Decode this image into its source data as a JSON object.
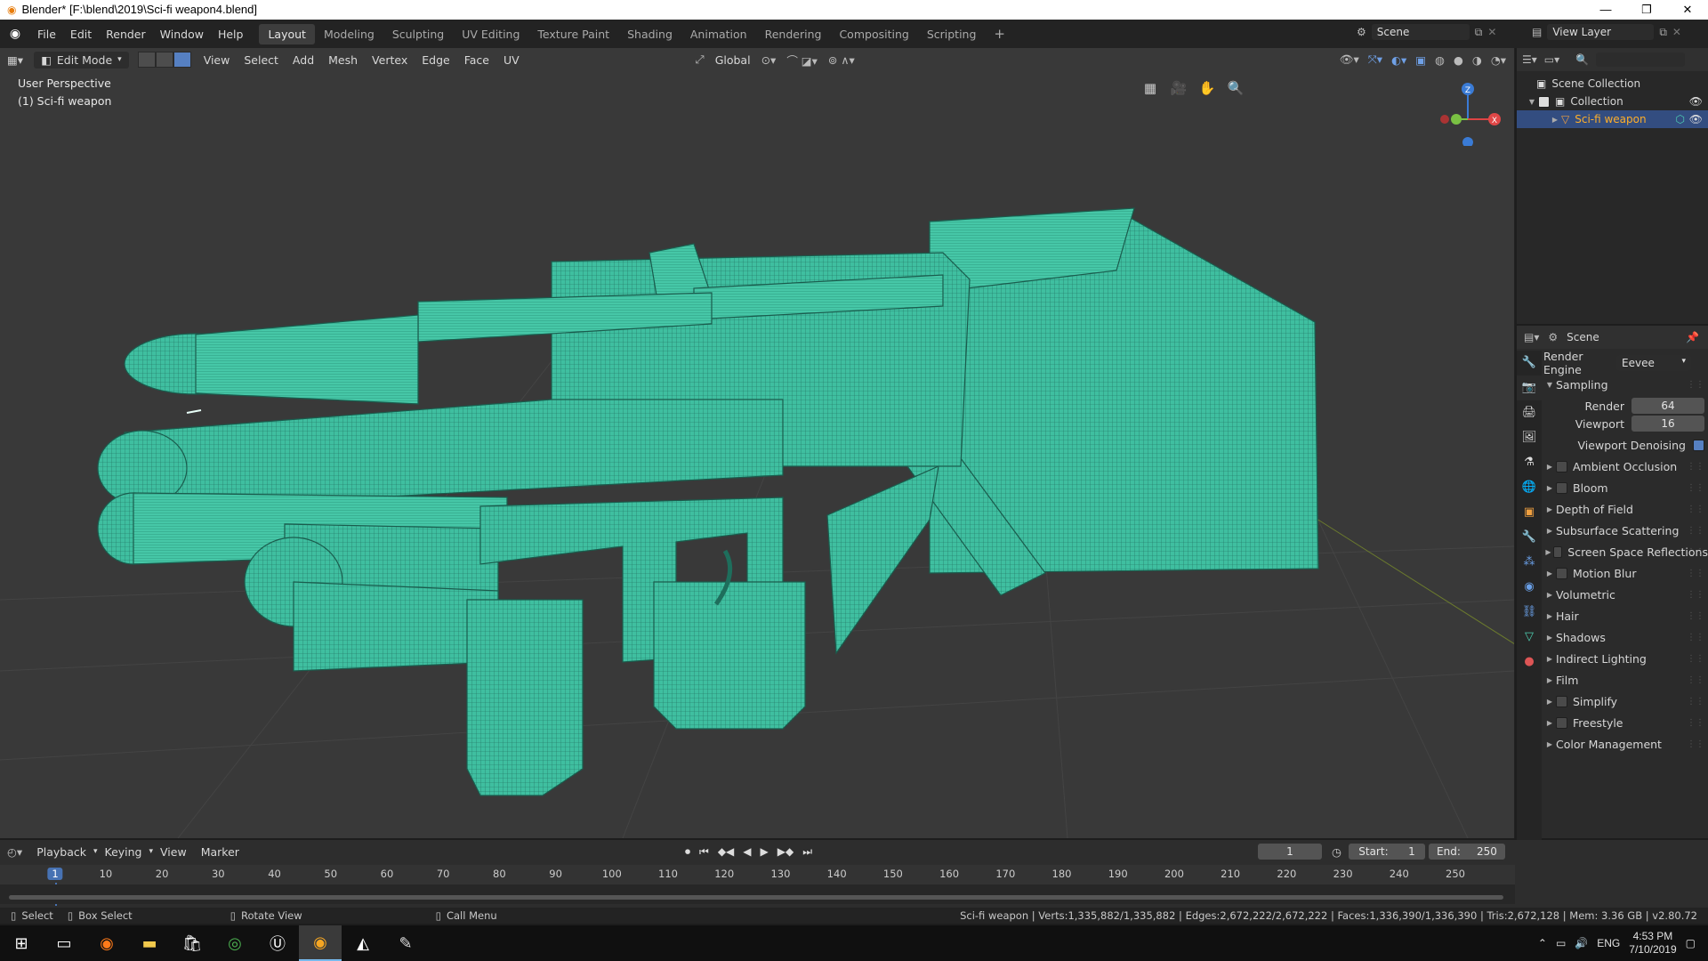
{
  "window": {
    "title": "Blender* [F:\\blend\\2019\\Sci-fi weapon4.blend]",
    "controls": [
      "—",
      "❐",
      "✕"
    ]
  },
  "menu": [
    "File",
    "Edit",
    "Render",
    "Window",
    "Help"
  ],
  "workspaces": [
    "Layout",
    "Modeling",
    "Sculpting",
    "UV Editing",
    "Texture Paint",
    "Shading",
    "Animation",
    "Rendering",
    "Compositing",
    "Scripting"
  ],
  "active_workspace": "Layout",
  "scene_field": "Scene",
  "view_layer_field": "View Layer",
  "viewport": {
    "mode": "Edit Mode",
    "menus": [
      "View",
      "Select",
      "Add",
      "Mesh",
      "Vertex",
      "Edge",
      "Face",
      "UV"
    ],
    "orientation": "Global",
    "overlay_line1": "User Perspective",
    "overlay_line2": "(1) Sci-fi weapon",
    "mesh_color": "#3fbfa0",
    "gizmo_axes": {
      "z": "Z",
      "y": "Y",
      "x": "X"
    }
  },
  "outliner": {
    "root": "Scene Collection",
    "collection": "Collection",
    "object": "Sci-fi weapon"
  },
  "properties": {
    "context": "Scene",
    "render_engine_label": "Render Engine",
    "render_engine": "Eevee",
    "sampling_label": "Sampling",
    "render_label": "Render",
    "render_samples": "64",
    "viewport_label": "Viewport",
    "viewport_samples": "16",
    "denoise_label": "Viewport Denoising",
    "panels": [
      {
        "label": "Ambient Occlusion",
        "checkbox": true
      },
      {
        "label": "Bloom",
        "checkbox": true
      },
      {
        "label": "Depth of Field",
        "checkbox": false
      },
      {
        "label": "Subsurface Scattering",
        "checkbox": false
      },
      {
        "label": "Screen Space Reflections",
        "checkbox": true
      },
      {
        "label": "Motion Blur",
        "checkbox": true
      },
      {
        "label": "Volumetric",
        "checkbox": false
      },
      {
        "label": "Hair",
        "checkbox": false
      },
      {
        "label": "Shadows",
        "checkbox": false
      },
      {
        "label": "Indirect Lighting",
        "checkbox": false
      },
      {
        "label": "Film",
        "checkbox": false
      },
      {
        "label": "Simplify",
        "checkbox": true
      },
      {
        "label": "Freestyle",
        "checkbox": true
      },
      {
        "label": "Color Management",
        "checkbox": false
      }
    ]
  },
  "timeline": {
    "menus": [
      "Playback",
      "Keying",
      "View",
      "Marker"
    ],
    "current_frame": "1",
    "start_label": "Start:",
    "start": "1",
    "end_label": "End:",
    "end": "250",
    "ticks": [
      "1",
      "10",
      "20",
      "30",
      "40",
      "50",
      "60",
      "70",
      "80",
      "90",
      "100",
      "110",
      "120",
      "130",
      "140",
      "150",
      "160",
      "170",
      "180",
      "190",
      "200",
      "210",
      "220",
      "230",
      "240",
      "250"
    ]
  },
  "status": {
    "select": "Select",
    "box_select": "Box Select",
    "rotate": "Rotate View",
    "call_menu": "Call Menu",
    "stats": "Sci-fi weapon | Verts:1,335,882/1,335,882 | Edges:2,672,222/2,672,222 | Faces:1,336,390/1,336,390 | Tris:2,672,128 | Mem: 3.36 GB | v2.80.72"
  },
  "taskbar": {
    "lang": "ENG",
    "time": "4:53 PM",
    "date": "7/10/2019"
  }
}
